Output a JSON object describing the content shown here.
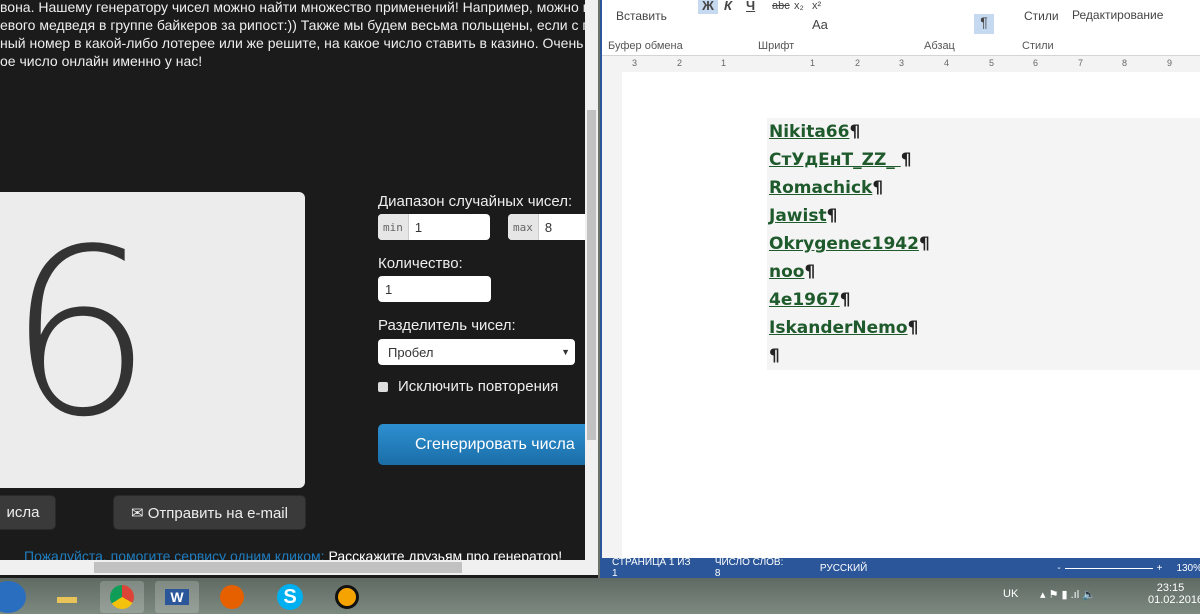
{
  "browser": {
    "intro_lines": [
      "вона. Нашему генератору чисел можно найти множество применений! Например, можно прове",
      "евого медведя в группе байкеров за рипост:)) Также мы будем весьма польщены, если с помо",
      "ный номер в какой-либо лотерее или же решите, на какое число ставить в казино. Очень наде",
      "ое число онлайн именно у нас!"
    ],
    "result": "6",
    "range_label": "Диапазон случайных чисел:",
    "min_addon": "min",
    "min_value": "1",
    "max_addon": "max",
    "max_value": "8",
    "count_label": "Количество:",
    "count_value": "1",
    "separator_label": "Разделитель чисел:",
    "separator_value": "Пробел",
    "exclude_label": "Исключить повторения",
    "generate_button": "Сгенерировать числа",
    "copy_button": "исла",
    "email_button": "✉ Отправить на e-mail",
    "help_text": "Пожалуйста, помогите сервису одним кликом:",
    "share_text": "Расскажите друзьям про генератор!",
    "accent": "#1f7dbf"
  },
  "word": {
    "ribbon": {
      "paste": "Вставить",
      "styles": "Стили",
      "editing": "Редактирование",
      "bold": "Ж",
      "italic": "К",
      "underline": "Ч",
      "strike": "abc",
      "sub": "x₂",
      "sup": "x²",
      "font_size_btn": "Aa",
      "pilcrow": "¶",
      "groups": [
        "Буфер обмена",
        "Шрифт",
        "Абзац",
        "Стили"
      ]
    },
    "ruler_ticks": [
      "3",
      "2",
      "1",
      "1",
      "2",
      "3",
      "4",
      "5",
      "6",
      "7",
      "8",
      "9"
    ],
    "lines": [
      "Nikita66",
      "СтУдЕнТ_ZZ_ ",
      "Romachick",
      "Jawist",
      "Okrygenec1942",
      "noo",
      "4e1967",
      "IskanderNemo",
      ""
    ],
    "pilcrow": "¶",
    "status": {
      "page": "СТРАНИЦА 1 ИЗ 1",
      "words": "ЧИСЛО СЛОВ: 8",
      "language": "РУССКИЙ",
      "zoom": "130%",
      "zoom_minus": "-",
      "zoom_plus": "+"
    },
    "text_color": "#1e5a2b",
    "status_color": "#2b579a"
  },
  "taskbar": {
    "lang": "UK",
    "time": "23:15",
    "date": "01.02.2016",
    "word_icon": "W",
    "skype_icon": "S"
  }
}
